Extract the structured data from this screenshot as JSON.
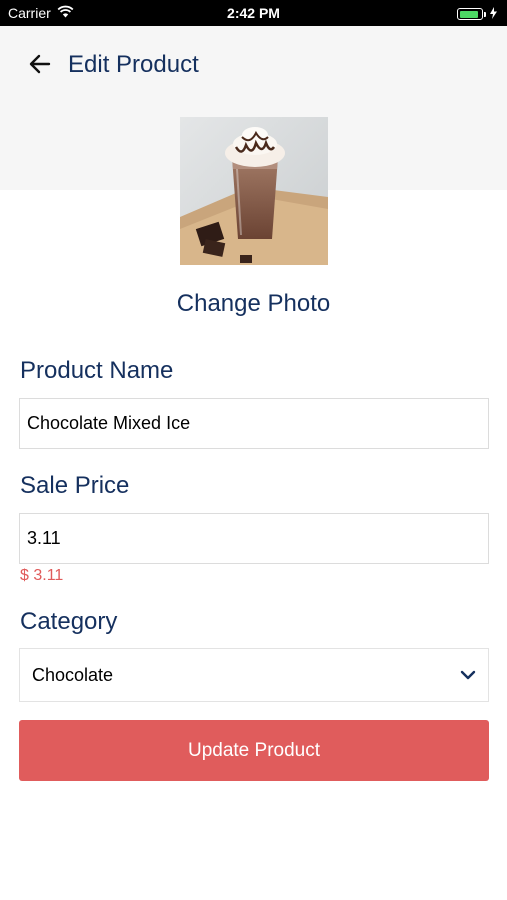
{
  "status_bar": {
    "carrier": "Carrier",
    "time": "2:42 PM",
    "icons": [
      "wifi-icon",
      "battery-icon",
      "charging-bolt-icon"
    ]
  },
  "header": {
    "title": "Edit Product",
    "back_icon": "arrow-left-icon"
  },
  "photo": {
    "image": "chocolate milkshake in glass with whipped cream and chocolate pieces",
    "change_label": "Change Photo"
  },
  "form": {
    "product_name": {
      "label": "Product Name",
      "value": "Chocolate Mixed Ice"
    },
    "sale_price": {
      "label": "Sale Price",
      "value": "3.11",
      "formatted": "$ 3.11"
    },
    "category": {
      "label": "Category",
      "selected": "Chocolate",
      "icon": "chevron-down-icon"
    },
    "submit_label": "Update Product"
  },
  "colors": {
    "primary_text": "#15305e",
    "accent": "#e05c5c",
    "header_bg": "#f6f6f6",
    "battery_green": "#4cd964"
  }
}
